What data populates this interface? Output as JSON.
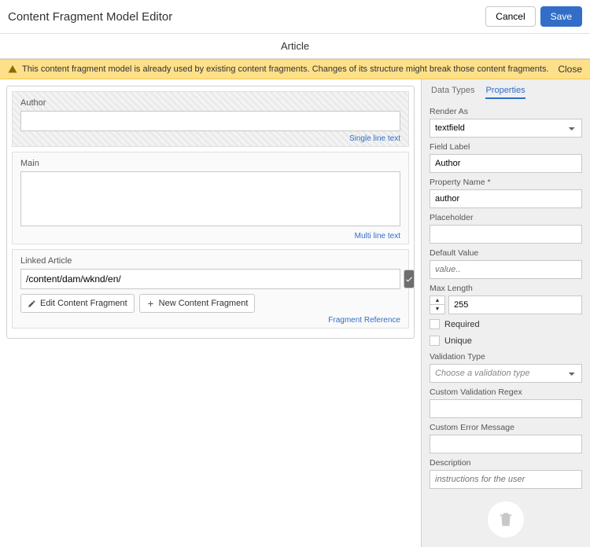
{
  "header": {
    "title": "Content Fragment Model Editor",
    "cancel": "Cancel",
    "save": "Save"
  },
  "subheader": "Article",
  "banner": {
    "message": "This content fragment model is already used by existing content fragments. Changes of its structure might break those content fragments.",
    "close": "Close"
  },
  "canvas": {
    "author": {
      "label": "Author",
      "tag": "Single line text",
      "value": ""
    },
    "main": {
      "label": "Main",
      "tag": "Multi line text",
      "value": ""
    },
    "linked": {
      "label": "Linked Article",
      "path": "/content/dam/wknd/en/",
      "edit": "Edit Content Fragment",
      "newcf": "New Content Fragment",
      "tag": "Fragment Reference"
    }
  },
  "tabs": {
    "datatypes": "Data Types",
    "properties": "Properties"
  },
  "props": {
    "renderAs": {
      "label": "Render As",
      "value": "textfield"
    },
    "fieldLabel": {
      "label": "Field Label",
      "value": "Author"
    },
    "propertyName": {
      "label": "Property Name *",
      "value": "author"
    },
    "placeholder": {
      "label": "Placeholder",
      "value": ""
    },
    "defaultValue": {
      "label": "Default Value",
      "placeholder": "value..",
      "value": ""
    },
    "maxLength": {
      "label": "Max Length",
      "value": "255"
    },
    "required": "Required",
    "unique": "Unique",
    "validationType": {
      "label": "Validation Type",
      "placeholder": "Choose a validation type"
    },
    "customRegex": {
      "label": "Custom Validation Regex",
      "value": ""
    },
    "customError": {
      "label": "Custom Error Message",
      "value": ""
    },
    "description": {
      "label": "Description",
      "placeholder": "instructions for the user",
      "value": ""
    }
  }
}
